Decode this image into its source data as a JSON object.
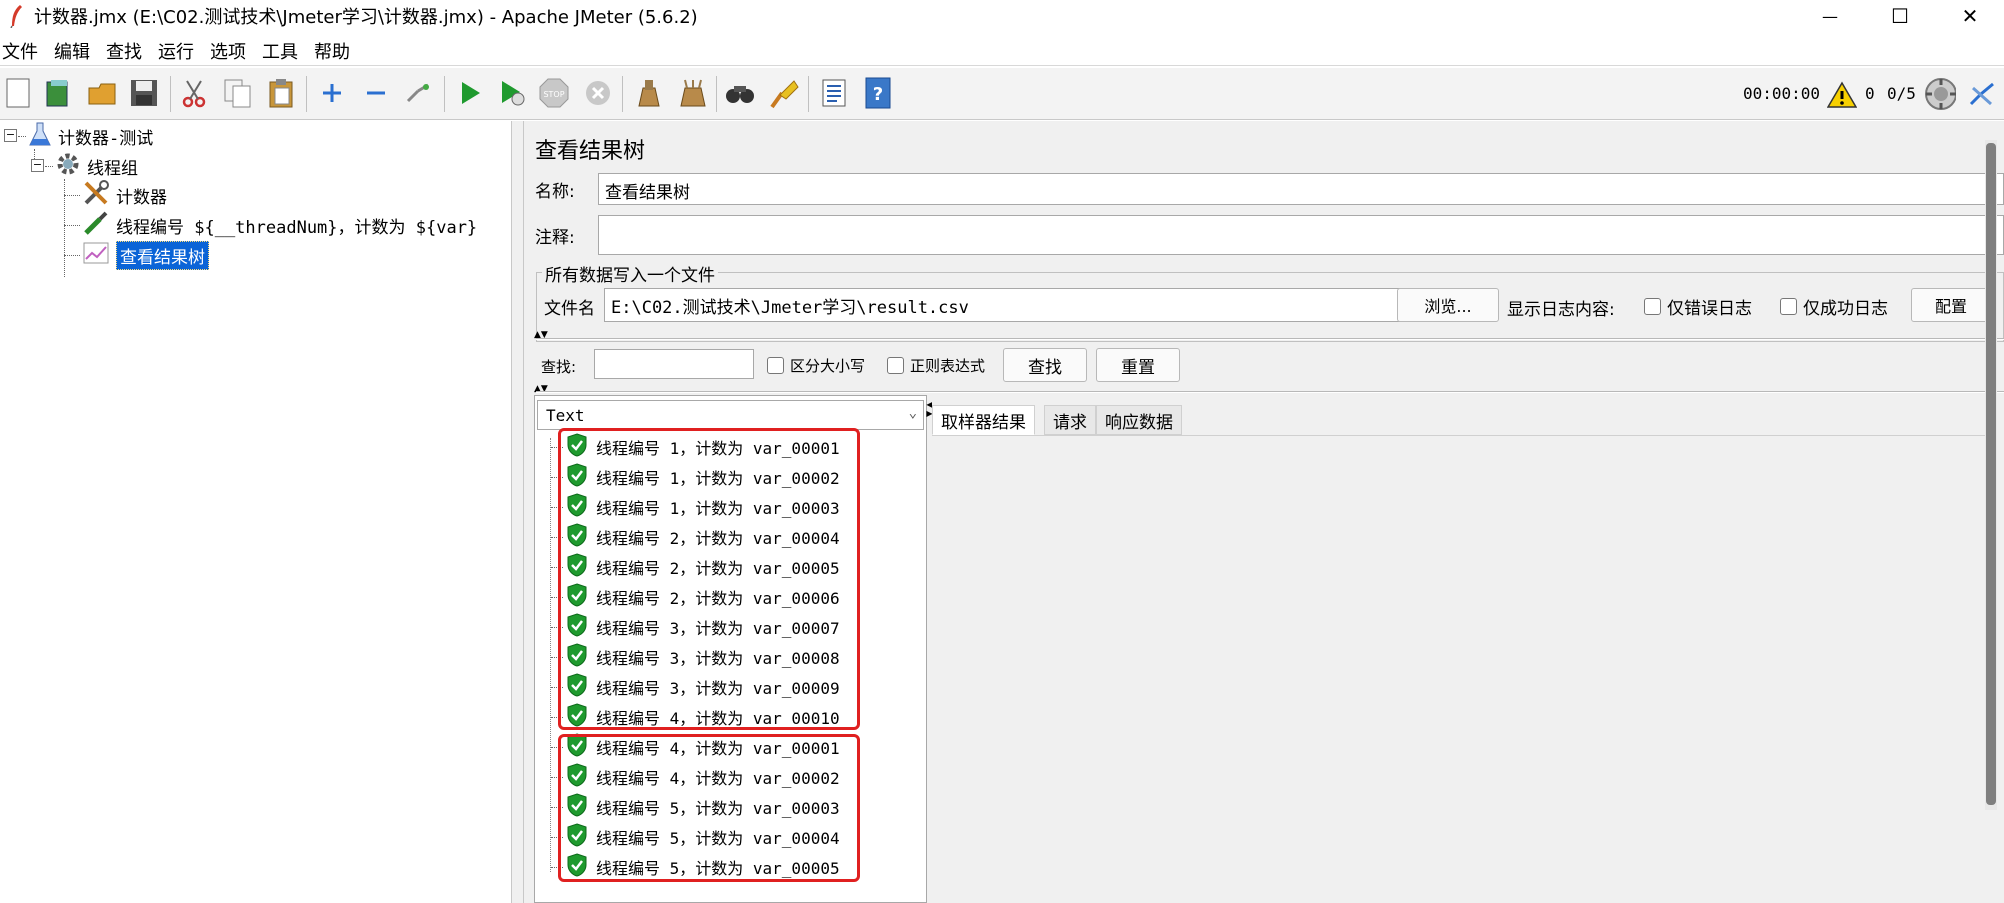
{
  "window": {
    "title": "计数器.jmx (E:\\C02.测试技术\\Jmeter学习\\计数器.jmx) - Apache JMeter (5.6.2)",
    "minimize_glyph": "—",
    "maximize_glyph": "☐",
    "close_glyph": "✕"
  },
  "menu": [
    "文件",
    "编辑",
    "查找",
    "运行",
    "选项",
    "工具",
    "帮助"
  ],
  "toolbar": {
    "elapsed_time": "00:00:00",
    "error_count": "0",
    "threads": "0/5",
    "icons": [
      "new-icon",
      "templates-icon",
      "open-icon",
      "save-icon",
      "cut-icon",
      "copy-icon",
      "paste-icon",
      "expand-icon",
      "collapse-icon",
      "toggle-icon",
      "start-icon",
      "start-no-timers-icon",
      "stop-icon",
      "shutdown-icon",
      "clear-icon",
      "clear-all-icon",
      "search-icon",
      "reset-search-icon",
      "function-helper-icon",
      "help-icon"
    ]
  },
  "tree": {
    "root": "计数器-测试",
    "thread_group": "线程组",
    "children": [
      "计数器",
      "线程编号 ${__threadNum}，计数为 ${var}",
      "查看结果树"
    ],
    "selected": "查看结果树"
  },
  "panel": {
    "title": "查看结果树",
    "name_label": "名称:",
    "name_value": "查看结果树",
    "comment_label": "注释:",
    "comment_value": "",
    "file_section_title": "所有数据写入一个文件",
    "file_label": "文件名",
    "file_value": "E:\\C02.测试技术\\Jmeter学习\\result.csv",
    "browse_button": "浏览...",
    "log_label": "显示日志内容:",
    "errors_only": "仅错误日志",
    "success_only": "仅成功日志",
    "config_button": "配置"
  },
  "search": {
    "label": "查找:",
    "value": "",
    "case_sensitive": "区分大小写",
    "regex": "正则表达式",
    "find_button": "查找",
    "reset_button": "重置"
  },
  "results": {
    "renderer": "Text",
    "items": [
      "线程编号 1，计数为 var_00001",
      "线程编号 1，计数为 var_00002",
      "线程编号 1，计数为 var_00003",
      "线程编号 2，计数为 var_00004",
      "线程编号 2，计数为 var_00005",
      "线程编号 2，计数为 var_00006",
      "线程编号 3，计数为 var_00007",
      "线程编号 3，计数为 var_00008",
      "线程编号 3，计数为 var_00009",
      "线程编号 4，计数为 var_00010",
      "线程编号 4，计数为 var_00001",
      "线程编号 4，计数为 var_00002",
      "线程编号 5，计数为 var_00003",
      "线程编号 5，计数为 var_00004",
      "线程编号 5，计数为 var_00005"
    ]
  },
  "tabs": [
    "取样器结果",
    "请求",
    "响应数据"
  ],
  "colors": {
    "accent_selection": "#0a64d7",
    "highlight_box": "#e02020",
    "success_icon": "#1f9a2e",
    "panel_bg": "#f0f0f0"
  }
}
